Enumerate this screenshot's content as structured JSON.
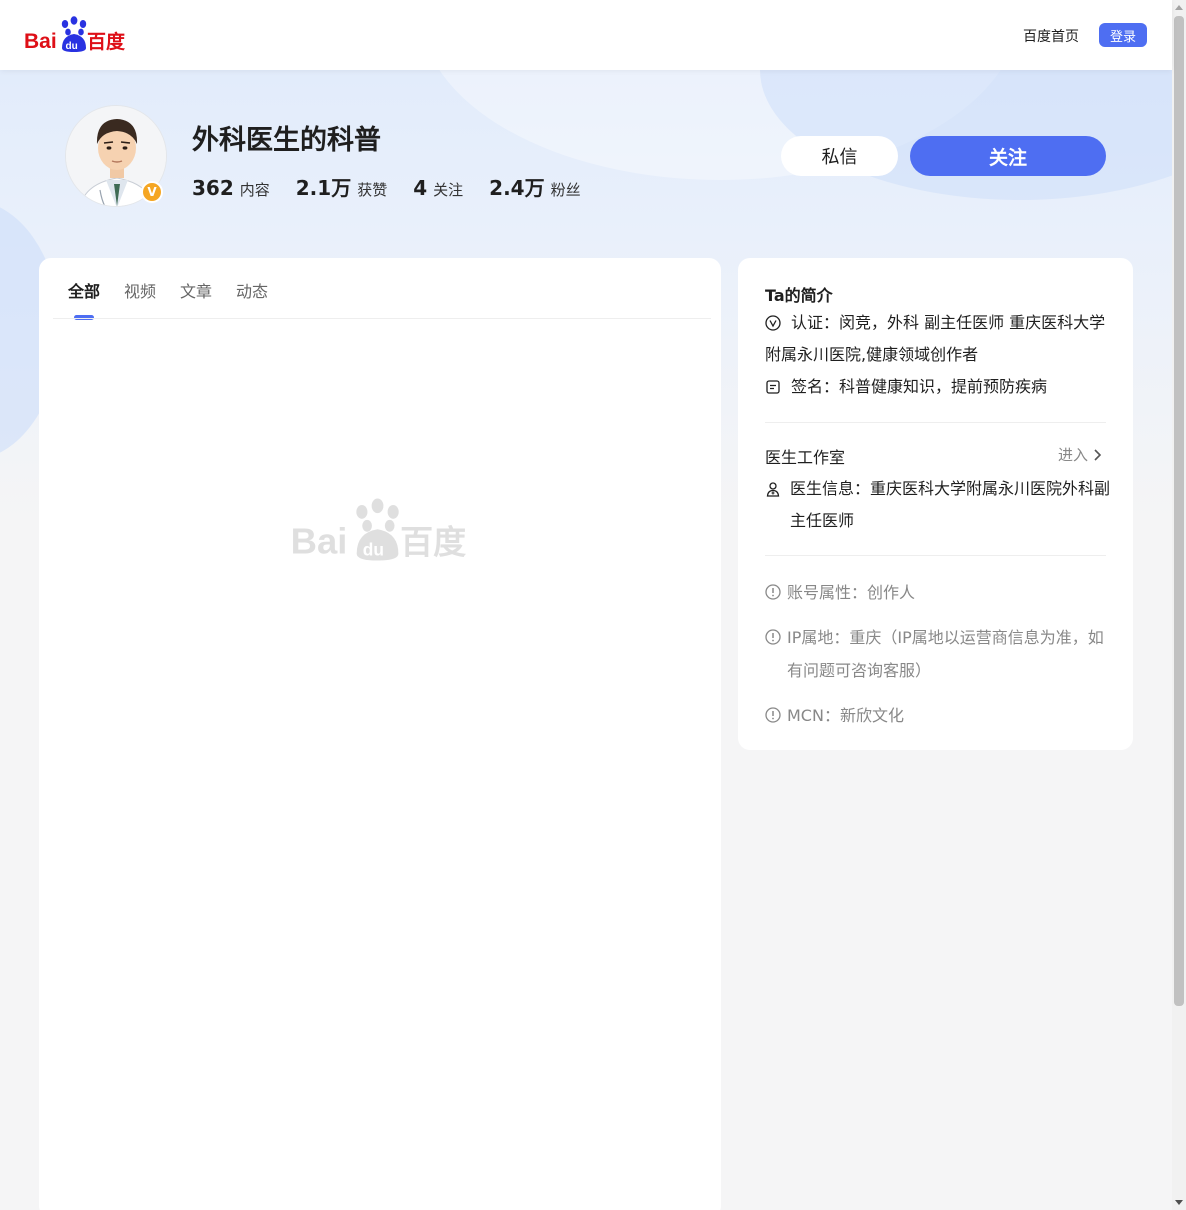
{
  "header": {
    "logo_alt": "Bai du 百度",
    "home_link": "百度首页",
    "login_button": "登录"
  },
  "profile": {
    "name": "外科医生的科普",
    "verified_mark": "V",
    "stats": [
      {
        "value": "362",
        "label": "内容"
      },
      {
        "value": "2.1万",
        "label": "获赞"
      },
      {
        "value": "4",
        "label": "关注"
      },
      {
        "value": "2.4万",
        "label": "粉丝"
      }
    ],
    "message_button": "私信",
    "follow_button": "关注"
  },
  "content": {
    "tabs": [
      {
        "label": "全部",
        "active": true
      },
      {
        "label": "视频",
        "active": false
      },
      {
        "label": "文章",
        "active": false
      },
      {
        "label": "动态",
        "active": false
      }
    ]
  },
  "intro": {
    "title": "Ta的简介",
    "certification": "认证：闵竞，外科 副主任医师 重庆医科大学附属永川医院,健康领域创作者",
    "signature": "签名：科普健康知识，提前预防疾病",
    "studio_title": "医生工作室",
    "studio_enter": "进入",
    "doctor_info": "医生信息：重庆医科大学附属永川医院外科副主任医师",
    "account_type": "账号属性：创作人",
    "ip_location": "IP属地：重庆（IP属地以运营商信息为准，如有问题可咨询客服）",
    "mcn": "MCN：新欣文化"
  },
  "colors": {
    "brand_blue": "#4e6ef2",
    "baidu_red": "#de0f17",
    "baidu_blue": "#2932e1",
    "badge_orange": "#f5a623"
  }
}
